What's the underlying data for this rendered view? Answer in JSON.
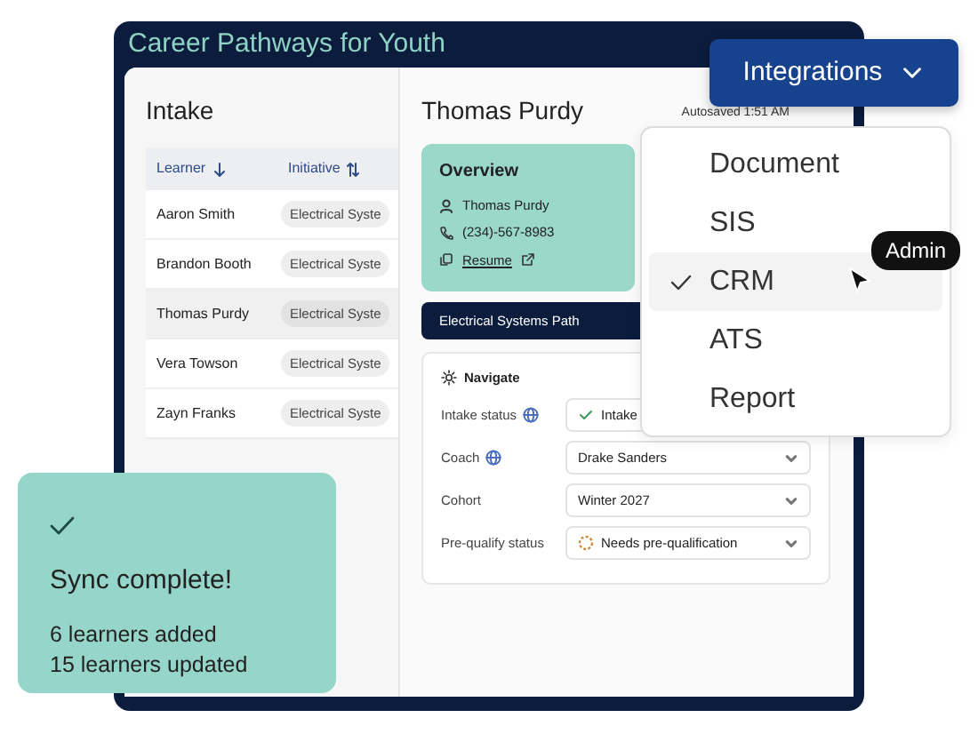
{
  "window": {
    "title": "Career Pathways for Youth"
  },
  "intake": {
    "title": "Intake",
    "columns": [
      {
        "label": "Learner",
        "sorted": true
      },
      {
        "label": "Initiative",
        "sorted": false
      }
    ],
    "rows": [
      {
        "learner": "Aaron Smith",
        "initiative": "Electrical Syste",
        "selected": false
      },
      {
        "learner": "Brandon Booth",
        "initiative": "Electrical Syste",
        "selected": false
      },
      {
        "learner": "Thomas Purdy",
        "initiative": "Electrical Syste",
        "selected": true
      },
      {
        "learner": "Vera Towson",
        "initiative": "Electrical Syste",
        "selected": false
      },
      {
        "learner": "Zayn Franks",
        "initiative": "Electrical Syste",
        "selected": false
      }
    ]
  },
  "detail": {
    "name": "Thomas Purdy",
    "autosave": "Autosaved 1:51 AM",
    "overview": {
      "title": "Overview",
      "person": "Thomas Purdy",
      "phone": "(234)-567-8983",
      "resume": "Resume"
    },
    "path": "Electrical Systems Path",
    "navigate": {
      "title": "Navigate",
      "fields": [
        {
          "label": "Intake status",
          "global": true,
          "value": "Intake",
          "kind": "done"
        },
        {
          "label": "Coach",
          "global": true,
          "value": "Drake Sanders",
          "kind": "plain"
        },
        {
          "label": "Cohort",
          "global": false,
          "value": "Winter 2027",
          "kind": "plain"
        },
        {
          "label": "Pre-qualify status",
          "global": false,
          "value": "Needs pre-qualification",
          "kind": "pending"
        }
      ]
    }
  },
  "integrations": {
    "label": "Integrations",
    "expanded": true,
    "items": [
      {
        "label": "Document",
        "selected": false
      },
      {
        "label": "SIS",
        "selected": false
      },
      {
        "label": "CRM",
        "selected": true
      },
      {
        "label": "ATS",
        "selected": false
      },
      {
        "label": "Report",
        "selected": false
      }
    ]
  },
  "tooltip": "Admin",
  "toast": {
    "title": "Sync complete!",
    "lines": [
      "6 learners added",
      "15 learners updated"
    ]
  }
}
